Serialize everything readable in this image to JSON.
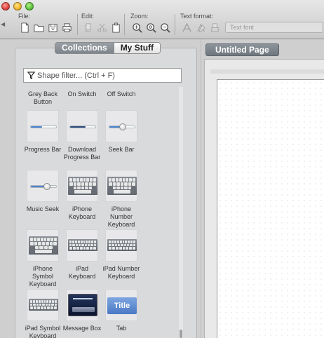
{
  "toolbar": {
    "groups": {
      "file": {
        "label": "File:"
      },
      "edit": {
        "label": "Edit:"
      },
      "zoom": {
        "label": "Zoom:"
      },
      "text_format": {
        "label": "Text format:",
        "font_placeholder": "Text font"
      }
    },
    "icons": {
      "file": [
        "new-document-icon",
        "open-folder-icon",
        "save-icon",
        "print-icon"
      ],
      "edit": [
        "copy-icon",
        "cut-icon",
        "paste-icon"
      ],
      "zoom": [
        "zoom-in-icon",
        "zoom-reset-icon",
        "zoom-out-icon"
      ],
      "text_format": [
        "font-style-icon",
        "font-color-icon",
        "font-clear-icon"
      ]
    }
  },
  "left_panel": {
    "segments": {
      "collections": "Collections",
      "my_stuff": "My Stuff",
      "selected": "Collections"
    },
    "filter": {
      "placeholder": "Shape filter... (Ctrl + F)"
    },
    "shapes": [
      {
        "label": "Grey Back Button"
      },
      {
        "label": "On Switch"
      },
      {
        "label": "Off Switch"
      },
      {
        "label": "Progress Bar"
      },
      {
        "label": "Download Progress Bar"
      },
      {
        "label": "Seek Bar"
      },
      {
        "label": "Music Seek"
      },
      {
        "label": "iPhone Keyboard"
      },
      {
        "label": "iPhone Number Keyboard"
      },
      {
        "label": "iPhone Symbol Keyboard"
      },
      {
        "label": "iPad Keyboard"
      },
      {
        "label": "iPad Number Keyboard"
      },
      {
        "label": "iPad Symbol Keyboard"
      },
      {
        "label": "Message Box"
      },
      {
        "label": "Tab",
        "thumb_text": "Title"
      }
    ]
  },
  "page": {
    "tab_title": "Untitled Page"
  },
  "colors": {
    "accent_blue": "#4b86d0",
    "tab_gray": "#7d848b"
  }
}
